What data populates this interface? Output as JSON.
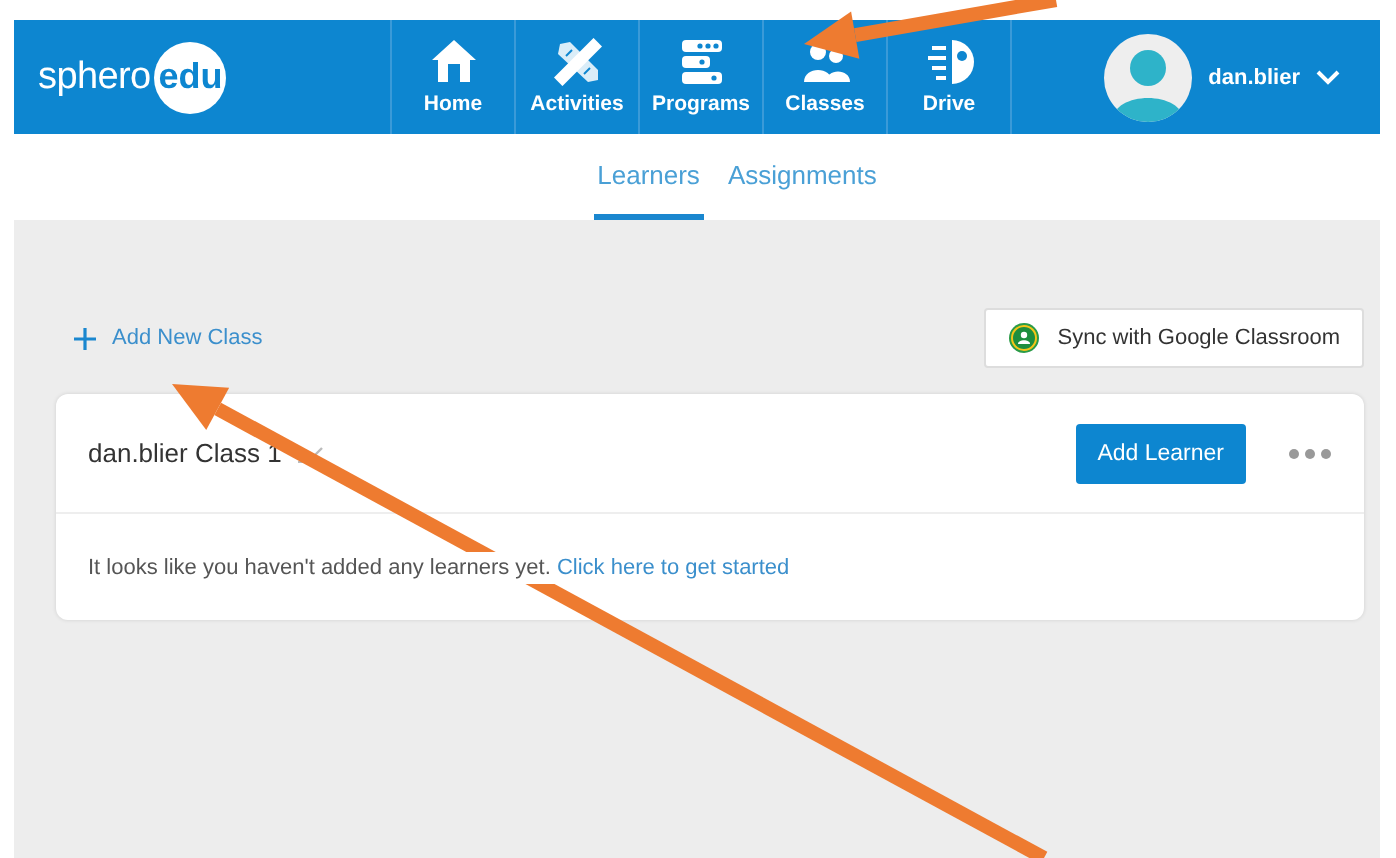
{
  "header": {
    "logo": {
      "word": "sphero",
      "badge": "edu"
    },
    "nav": [
      {
        "label": "Home",
        "kind": "house"
      },
      {
        "label": "Activities",
        "kind": "tools"
      },
      {
        "label": "Programs",
        "kind": "blocks"
      },
      {
        "label": "Classes",
        "kind": "people"
      },
      {
        "label": "Drive",
        "kind": "drive"
      }
    ],
    "user": {
      "name": "dan.blier"
    }
  },
  "tabs": [
    {
      "label": "Learners",
      "selected": true
    },
    {
      "label": "Assignments",
      "selected": false
    }
  ],
  "toolbar": {
    "add_class": "Add New Class",
    "sync_button": "Sync with Google Classroom"
  },
  "class_card": {
    "name": "dan.blier Class 1",
    "add_button": "Add Learner",
    "message": "It looks like you haven't added any learners yet.",
    "link": "Click here to get started"
  },
  "annotations": [
    {
      "kind": "arrow"
    },
    {
      "kind": "arrow"
    }
  ]
}
